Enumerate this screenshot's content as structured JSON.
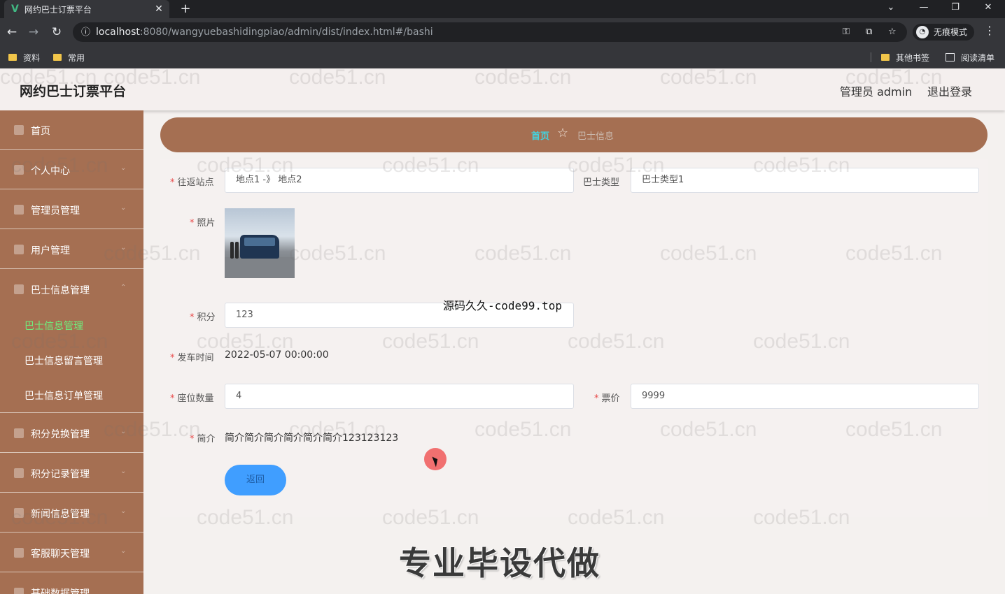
{
  "browser": {
    "tab_title": "网约巴士订票平台",
    "tab_logo": "V",
    "tab_close": "✕",
    "new_tab": "+",
    "url_host": "localhost",
    "url_rest": ":8080/wangyuebashidingpiao/admin/dist/index.html#/bashi",
    "incognito_label": "无痕模式",
    "bookmarks": [
      "资料",
      "常用"
    ],
    "other_bookmarks": "其他书签",
    "reading_list": "阅读清单"
  },
  "header": {
    "title": "网约巴士订票平台",
    "user": "管理员 admin",
    "logout": "退出登录"
  },
  "sidebar": {
    "items": [
      {
        "label": "首页",
        "icon": "home-icon"
      },
      {
        "label": "个人中心",
        "icon": "user-icon"
      },
      {
        "label": "管理员管理",
        "icon": "mail-icon"
      },
      {
        "label": "用户管理",
        "icon": "user-list-icon"
      },
      {
        "label": "巴士信息管理",
        "icon": "bus-info-icon"
      },
      {
        "label": "积分兑换管理",
        "icon": "exchange-icon"
      },
      {
        "label": "积分记录管理",
        "icon": "grid-icon"
      },
      {
        "label": "新闻信息管理",
        "icon": "news-icon"
      },
      {
        "label": "客服聊天管理",
        "icon": "chat-icon"
      },
      {
        "label": "基础数据管理",
        "icon": "data-icon"
      }
    ],
    "subitems": [
      "巴士信息管理",
      "巴士信息留言管理",
      "巴士信息订单管理"
    ]
  },
  "breadcrumb": {
    "home": "首页",
    "current": "巴士信息"
  },
  "form": {
    "route_label": "往返站点",
    "route_value": "地点1 -》 地点2",
    "bus_type_label": "巴士类型",
    "bus_type_value": "巴士类型1",
    "photo_label": "照片",
    "points_label": "积分",
    "points_value": "123",
    "depart_label": "发车时间",
    "depart_value": "2022-05-07 00:00:00",
    "seats_label": "座位数量",
    "seats_value": "4",
    "price_label": "票价",
    "price_value": "9999",
    "intro_label": "简介",
    "intro_value": "简介简介简介简介简介简介123123123",
    "back_button": "返回",
    "required_mark": "*"
  },
  "overlays": {
    "watermark": "code51.cn",
    "source_text": "源码久久-code99.top",
    "promo_text": "专业毕设代做"
  },
  "colors": {
    "sidebar_bg": "#a56f52",
    "active_submenu": "#6ef07d",
    "breadcrumb_home": "#42d3e0",
    "primary_button": "#409eff",
    "required": "#e84a4a"
  }
}
